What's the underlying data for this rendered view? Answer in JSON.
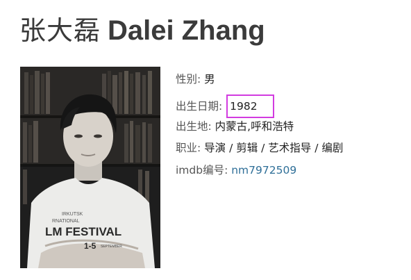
{
  "title": {
    "chinese_name": "张大磊",
    "english_name": "Dalei Zhang"
  },
  "photo": {
    "shirt_lines": [
      "IRKUTSK",
      "RNATIONAL",
      "LM FESTIVAL",
      "1-5",
      "SEPTEMBER"
    ]
  },
  "info": {
    "gender": {
      "label": "性别: ",
      "value": "男"
    },
    "birth_date": {
      "label": "出生日期: ",
      "value": "1982"
    },
    "birthplace": {
      "label": "出生地: ",
      "value": "内蒙古,呼和浩特"
    },
    "occupation": {
      "label": "职业: ",
      "value": "导演 / 剪辑 / 艺术指导 / 编剧"
    },
    "imdb": {
      "label": "imdb编号: ",
      "value": "nm7972509"
    }
  },
  "colors": {
    "highlight_border": "#d23be0",
    "link": "#2f6f98",
    "title_text": "#3a3a3a"
  }
}
